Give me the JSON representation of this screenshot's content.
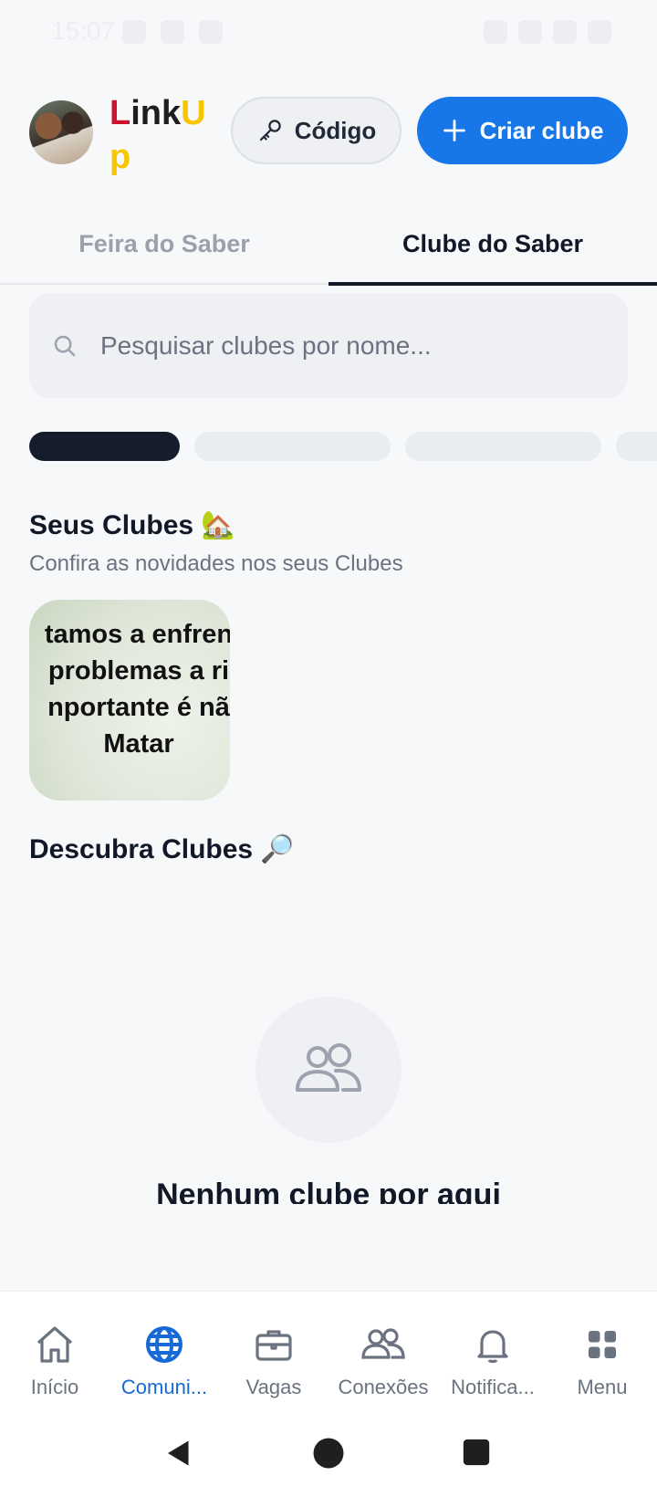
{
  "status_bar": {
    "time": "15:07"
  },
  "header": {
    "logo": {
      "part1": "L",
      "part2": "ink",
      "part3": "U",
      "part4": "p"
    },
    "code_button": "Código",
    "create_button": "Criar clube"
  },
  "tabs": [
    {
      "label": "Feira do Saber",
      "active": false
    },
    {
      "label": "Clube do Saber",
      "active": true
    }
  ],
  "search": {
    "placeholder": "Pesquisar clubes por nome..."
  },
  "your_clubs": {
    "title": "Seus Clubes 🏡",
    "subtitle": "Confira as novidades nos seus Clubes",
    "club_image_text": [
      "tamos a enfren",
      "problemas a ri",
      "nportante é nã",
      "Matar"
    ]
  },
  "discover": {
    "title": "Descubra Clubes 🔎",
    "empty_text": "Nenhum clube por aqui"
  },
  "bottom_nav": [
    {
      "label": "Início",
      "icon": "home-icon",
      "active": false
    },
    {
      "label": "Comuni...",
      "icon": "globe-icon",
      "active": true
    },
    {
      "label": "Vagas",
      "icon": "briefcase-icon",
      "active": false
    },
    {
      "label": "Conexões",
      "icon": "people-icon",
      "active": false
    },
    {
      "label": "Notifica...",
      "icon": "bell-icon",
      "active": false
    },
    {
      "label": "Menu",
      "icon": "grid-icon",
      "active": false
    }
  ],
  "colors": {
    "accent": "#1777e8",
    "active_nav": "#1669d6",
    "logo_red": "#d0112b",
    "logo_yellow": "#f7c600"
  }
}
